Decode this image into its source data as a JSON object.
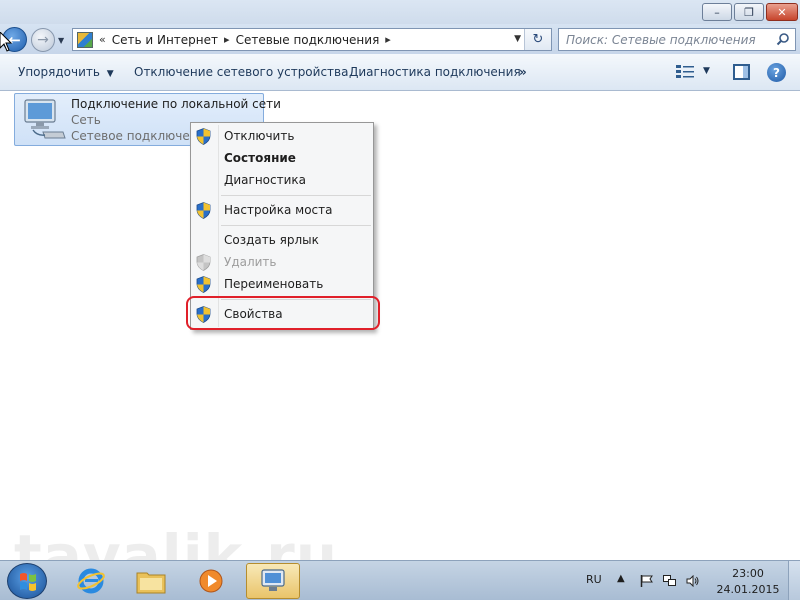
{
  "window": {
    "minimize_glyph": "–",
    "maximize_glyph": "❐",
    "close_glyph": "✕"
  },
  "nav": {
    "back_glyph": "←",
    "forward_glyph": "→",
    "breadcrumb_overflow": "«",
    "breadcrumb": [
      "Сеть и Интернет",
      "Сетевые подключения"
    ],
    "separator_glyph": "▸",
    "dropdown_glyph": "▼",
    "refresh_glyph": "↻",
    "search_placeholder": "Поиск: Сетевые подключения"
  },
  "command_bar": {
    "organize": "Упорядочить",
    "organize_arrow": "▼",
    "disable_device": "Отключение сетевого устройства",
    "diagnose": "Диагностика подключения",
    "more": "»",
    "help_glyph": "?"
  },
  "connection": {
    "name": "Подключение по локальной сети",
    "network": "Сеть",
    "device": "Сетевое подключение"
  },
  "context_menu": {
    "items": [
      {
        "label": "Отключить",
        "shield": true
      },
      {
        "label": "Состояние",
        "bold": true
      },
      {
        "label": "Диагностика"
      },
      {
        "label": "Настройка моста",
        "shield": true
      },
      {
        "label": "Создать ярлык"
      },
      {
        "label": "Удалить",
        "shield": true,
        "disabled": true
      },
      {
        "label": "Переименовать",
        "shield": true
      },
      {
        "label": "Свойства",
        "shield": true,
        "highlighted": true
      }
    ]
  },
  "watermark": "tavalik.ru",
  "taskbar": {
    "language": "RU",
    "tray_arrow": "▲",
    "time": "23:00",
    "date": "24.01.2015"
  },
  "colors": {
    "highlight_ring": "#e0202a",
    "accent_blue": "#1f5fae"
  }
}
